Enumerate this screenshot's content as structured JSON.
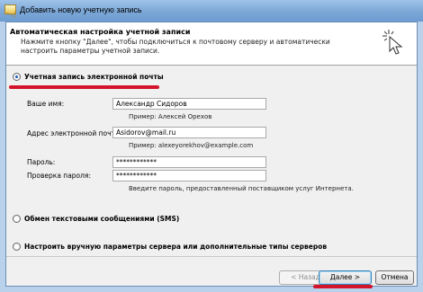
{
  "window": {
    "title": "Добавить новую учетную запись"
  },
  "header": {
    "title": "Автоматическая настройка учетной записи",
    "description": "Нажмите кнопку \"Далее\", чтобы подключиться к почтовому серверу и автоматически настроить параметры учетной записи."
  },
  "options": {
    "email_account": "Учетная запись электронной почты",
    "sms": "Обмен текстовыми сообщениями (SMS)",
    "manual": "Настроить вручную параметры сервера или дополнительные типы серверов"
  },
  "form": {
    "name_label": "Ваше имя:",
    "name_value": "Александр Сидоров",
    "name_example": "Пример: Алексей Орехов",
    "email_label": "Адрес электронной почты:",
    "email_value": "Asidorov@mail.ru",
    "email_example": "Пример: alexeyorekhov@example.com",
    "password_label": "Пароль:",
    "password_value": "************",
    "confirm_label": "Проверка пароля:",
    "confirm_value": "************",
    "password_hint": "Введите пароль, предоставленный поставщиком услуг Интернета."
  },
  "buttons": {
    "back": "< Назад",
    "next": "Далее >",
    "cancel": "Отмена"
  },
  "colors": {
    "accent_underline": "#d4142b",
    "titlebar": "#7ea9d8"
  }
}
